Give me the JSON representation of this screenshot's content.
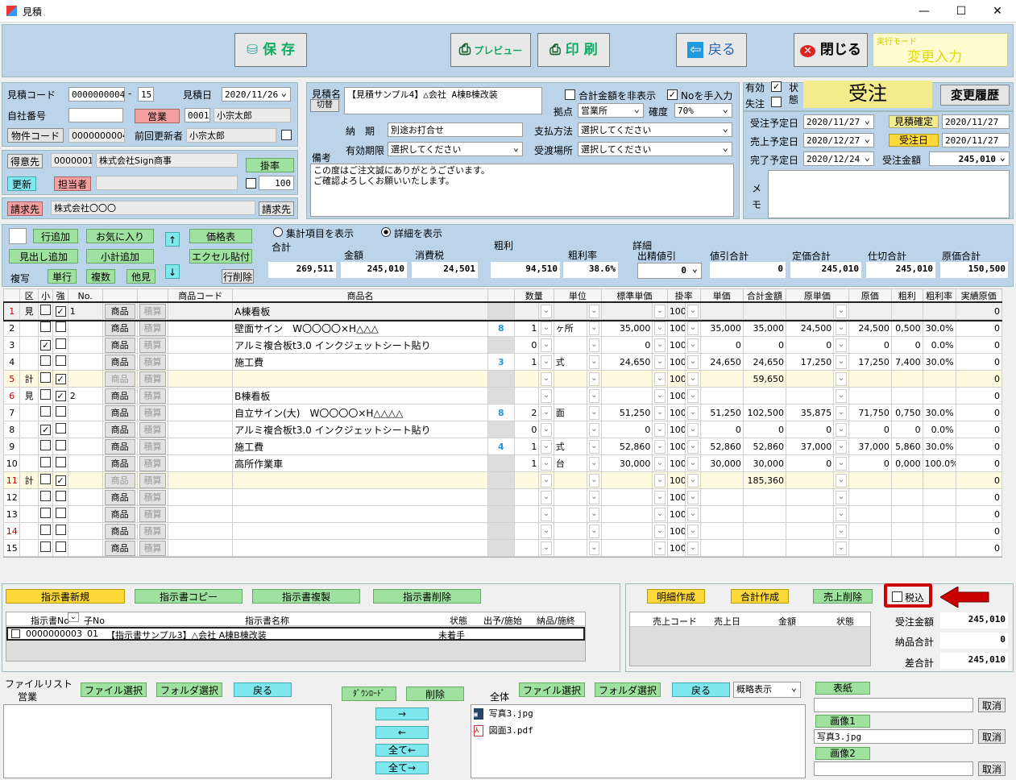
{
  "window": {
    "title": "見積",
    "min": "—",
    "max": "☐",
    "close": "✕"
  },
  "toolbar": {
    "save": "保 存",
    "preview": "プレビュー",
    "print": "印 刷",
    "back": "戻る",
    "close": "閉じる",
    "mode_label": "実行モード",
    "mode_value": "変更入力"
  },
  "left": {
    "quote_code_label": "見積コード",
    "quote_code": "0000000004",
    "quote_sep": "-",
    "quote_sub": "15",
    "quote_date_label": "見積日",
    "quote_date": "2020/11/26",
    "company_no_label": "自社番号",
    "sales_btn": "営業",
    "staff_code": "0001",
    "staff_name": "小宗太郎",
    "property_code_btn": "物件コード",
    "property_code": "0000000004",
    "last_updater_label": "前回更新者",
    "last_updater": "小宗太郎",
    "customer_btn": "得意先",
    "customer_code": "0000001",
    "customer_name": "株式会社Sign商事",
    "rate_btn": "掛率",
    "update_btn": "更新",
    "person_btn": "担当者",
    "rate_value": "100",
    "billing_btn": "請求先",
    "billing_name": "株式会社〇〇〇",
    "billing_action": "請求先"
  },
  "middle": {
    "quote_name_label": "見積名",
    "switch_btn": "切替",
    "quote_name": "【見積サンプル4】△会社 A棟B棟改装",
    "hide_total_label": "合計金額を非表示",
    "manual_no_label": "Noを手入力",
    "base_label": "拠点",
    "base_value": "営業所",
    "certainty_label": "確度",
    "certainty_value": "70%",
    "delivery_label": "納　期",
    "delivery_value": "別途お打合せ",
    "payment_label": "支払方法",
    "payment_value": "選択してください",
    "validity_label": "有効期限",
    "validity_value": "選択してください",
    "handover_label": "受渡場所",
    "handover_value": "選択してください",
    "notes_label": "備考",
    "notes_line1": "この度はご注文誠にありがとうございます。",
    "notes_line2": "ご確認よろしくお願いいたします。"
  },
  "right": {
    "valid_label": "有効",
    "lost_label": "失注",
    "status_label1": "状",
    "status_label2": "態",
    "status_value": "受注",
    "history_btn": "変更履歴",
    "order_plan_label": "受注予定日",
    "order_plan": "2020/11/27",
    "quote_confirm_btn": "見積確定",
    "quote_confirm_date": "2020/11/27",
    "sales_plan_label": "売上予定日",
    "sales_plan": "2020/12/27",
    "order_date_btn": "受注日",
    "order_date": "2020/11/27",
    "complete_plan_label": "完了予定日",
    "complete_plan": "2020/12/24",
    "order_amount_label": "受注金額",
    "order_amount": "245,010",
    "memo_label1": "メ",
    "memo_label2": "モ"
  },
  "summary": {
    "show_total_label": "集計項目を表示",
    "show_detail_label": "詳細を表示",
    "add_row": "行追加",
    "favorites": "お気に入り",
    "price_table": "価格表",
    "heading_add": "見出し追加",
    "subtotal_add": "小計追加",
    "excel_paste": "エクセル貼付",
    "copy_label": "複写",
    "single": "単行",
    "multi": "複数",
    "other": "他見",
    "delete_row": "行削除",
    "total_label": "合計",
    "amount_label": "金額",
    "tax_label": "消費税",
    "total": "269,511",
    "amount": "245,010",
    "tax": "24,501",
    "gross_label": "粗利",
    "gross_rate_label": "粗利率",
    "gross": "94,510",
    "gross_rate": "38.6%",
    "detail_label": "詳細",
    "discount_label": "出精値引",
    "discount": "0",
    "discount_total_label": "値引合計",
    "discount_total": "0",
    "list_total_label": "定価合計",
    "list_total": "245,010",
    "cost_total_label": "仕切合計",
    "cost_total": "245,010",
    "orig_total_label": "原価合計",
    "orig_total": "150,500"
  },
  "grid": {
    "headers": [
      "区",
      "小",
      "強",
      "No.",
      "",
      "",
      "商品コード",
      "商品名",
      "",
      "数量",
      "単位",
      "標準単価",
      "掛率",
      "単価",
      "合計金額",
      "原単価",
      "原価",
      "粗利",
      "粗利率",
      "実績原価"
    ],
    "rows": [
      {
        "n": "1",
        "k": "見",
        "s": false,
        "st": true,
        "no": "1",
        "name": "A棟看板",
        "badge": "",
        "qty": "",
        "unit": "",
        "std": "",
        "rate": "100",
        "price": "",
        "total": "",
        "ucost": "",
        "cost": "",
        "gp": "",
        "gpr": "",
        "act": "0",
        "type": "h"
      },
      {
        "n": "2",
        "k": "",
        "s": false,
        "st": false,
        "no": "",
        "name": "壁面サイン　W〇〇〇〇×H△△△",
        "badge": "8",
        "qty": "1",
        "unit": "ヶ所",
        "std": "35,000",
        "rate": "100",
        "price": "35,000",
        "total": "35,000",
        "ucost": "24,500",
        "cost": "24,500",
        "gp": "0,500",
        "gpr": "30.0%",
        "act": "0",
        "type": "n"
      },
      {
        "n": "3",
        "k": "",
        "s": true,
        "st": false,
        "no": "",
        "name": "アルミ複合板t3.0 インクジェットシート貼り",
        "badge": "",
        "qty": "0",
        "unit": "",
        "std": "0",
        "rate": "100",
        "price": "0",
        "total": "0",
        "ucost": "0",
        "cost": "0",
        "gp": "0",
        "gpr": "0.0%",
        "act": "0",
        "type": "n"
      },
      {
        "n": "4",
        "k": "",
        "s": false,
        "st": false,
        "no": "",
        "name": "施工費",
        "badge": "3",
        "qty": "1",
        "unit": "式",
        "std": "24,650",
        "rate": "100",
        "price": "24,650",
        "total": "24,650",
        "ucost": "17,250",
        "cost": "17,250",
        "gp": "7,400",
        "gpr": "30.0%",
        "act": "0",
        "type": "n"
      },
      {
        "n": "5",
        "k": "計",
        "s": false,
        "st": true,
        "no": "",
        "name": "",
        "badge": "",
        "qty": "",
        "unit": "",
        "std": "",
        "rate": "100",
        "price": "",
        "total": "59,650",
        "ucost": "",
        "cost": "",
        "gp": "",
        "gpr": "",
        "act": "0",
        "type": "t"
      },
      {
        "n": "6",
        "k": "見",
        "s": false,
        "st": true,
        "no": "2",
        "name": "B棟看板",
        "badge": "",
        "qty": "",
        "unit": "",
        "std": "",
        "rate": "100",
        "price": "",
        "total": "",
        "ucost": "",
        "cost": "",
        "gp": "",
        "gpr": "",
        "act": "0",
        "type": "h"
      },
      {
        "n": "7",
        "k": "",
        "s": false,
        "st": false,
        "no": "",
        "name": "自立サイン(大)　W〇〇〇〇×H△△△△",
        "badge": "8",
        "qty": "2",
        "unit": "面",
        "std": "51,250",
        "rate": "100",
        "price": "51,250",
        "total": "102,500",
        "ucost": "35,875",
        "cost": "71,750",
        "gp": "0,750",
        "gpr": "30.0%",
        "act": "0",
        "type": "n"
      },
      {
        "n": "8",
        "k": "",
        "s": true,
        "st": false,
        "no": "",
        "name": "アルミ複合板t3.0 インクジェットシート貼り",
        "badge": "",
        "qty": "0",
        "unit": "",
        "std": "0",
        "rate": "100",
        "price": "0",
        "total": "0",
        "ucost": "0",
        "cost": "0",
        "gp": "0",
        "gpr": "0.0%",
        "act": "0",
        "type": "n"
      },
      {
        "n": "9",
        "k": "",
        "s": false,
        "st": false,
        "no": "",
        "name": "施工費",
        "badge": "4",
        "qty": "1",
        "unit": "式",
        "std": "52,860",
        "rate": "100",
        "price": "52,860",
        "total": "52,860",
        "ucost": "37,000",
        "cost": "37,000",
        "gp": "5,860",
        "gpr": "30.0%",
        "act": "0",
        "type": "n"
      },
      {
        "n": "10",
        "k": "",
        "s": false,
        "st": false,
        "no": "",
        "name": "高所作業車",
        "badge": "",
        "qty": "1",
        "unit": "台",
        "std": "30,000",
        "rate": "100",
        "price": "30,000",
        "total": "30,000",
        "ucost": "0",
        "cost": "0",
        "gp": "0,000",
        "gpr": "100.0%",
        "act": "0",
        "type": "n"
      },
      {
        "n": "11",
        "k": "計",
        "s": false,
        "st": true,
        "no": "",
        "name": "",
        "badge": "",
        "qty": "",
        "unit": "",
        "std": "",
        "rate": "100",
        "price": "",
        "total": "185,360",
        "ucost": "",
        "cost": "",
        "gp": "",
        "gpr": "",
        "act": "0",
        "type": "t"
      },
      {
        "n": "12",
        "k": "",
        "s": false,
        "st": false,
        "no": "",
        "name": "",
        "badge": "",
        "qty": "",
        "unit": "",
        "std": "",
        "rate": "100",
        "price": "",
        "total": "",
        "ucost": "",
        "cost": "",
        "gp": "",
        "gpr": "",
        "act": "0",
        "type": "n"
      },
      {
        "n": "13",
        "k": "",
        "s": false,
        "st": false,
        "no": "",
        "name": "",
        "badge": "",
        "qty": "",
        "unit": "",
        "std": "",
        "rate": "100",
        "price": "",
        "total": "",
        "ucost": "",
        "cost": "",
        "gp": "",
        "gpr": "",
        "act": "0",
        "type": "n"
      },
      {
        "n": "14",
        "k": "",
        "s": false,
        "st": false,
        "no": "",
        "name": "",
        "badge": "",
        "qty": "",
        "unit": "",
        "std": "",
        "rate": "100",
        "price": "",
        "total": "",
        "ucost": "",
        "cost": "",
        "gp": "",
        "gpr": "",
        "act": "0",
        "type": "n"
      },
      {
        "n": "15",
        "k": "",
        "s": false,
        "st": false,
        "no": "",
        "name": "",
        "badge": "",
        "qty": "",
        "unit": "",
        "std": "",
        "rate": "100",
        "price": "",
        "total": "",
        "ucost": "",
        "cost": "",
        "gp": "",
        "gpr": "",
        "act": "0",
        "type": "n"
      }
    ],
    "product_btn": "商品",
    "estimate_btn": "積算"
  },
  "orders": {
    "new": "指示書新規",
    "copy": "指示書コピー",
    "dup": "指示書複製",
    "del": "指示書削除",
    "h_no": "指示書No",
    "h_sub": "子No",
    "h_name": "指示書名称",
    "h_status": "状態",
    "h_out": "出予/施始",
    "h_deliv": "納品/施終",
    "row_no": "0000000003",
    "row_sub": "01",
    "row_name": "【指示書サンプル3】△会社 A棟B棟改装",
    "row_status": "未着手"
  },
  "sales": {
    "detail_create": "明細作成",
    "total_create": "合計作成",
    "sales_delete": "売上削除",
    "tax_incl": "税込",
    "h_code": "売上コード",
    "h_date": "売上日",
    "h_amount": "金額",
    "h_status": "状態",
    "order_amount_label": "受注金額",
    "order_amount": "245,010",
    "deliv_total_label": "納品合計",
    "deliv_total": "0",
    "diff_label": "差合計",
    "diff": "245,010"
  },
  "files": {
    "list_label": "ファイルリスト",
    "sales_label": "営業",
    "file_select": "ファイル選択",
    "folder_select": "フォルダ選択",
    "back": "戻る",
    "download": "ﾀﾞｳﾝﾛｰﾄﾞ",
    "delete": "削除",
    "right": "→",
    "left": "←",
    "all_left": "全て←",
    "all_right": "全て→",
    "all_label": "全体",
    "file_select2": "ファイル選択",
    "folder_select2": "フォルダ選択",
    "back2": "戻る",
    "view_mode": "概略表示",
    "file1": "写真3.jpg",
    "file2": "図面3.pdf",
    "cover_btn": "表紙",
    "image1_btn": "画像1",
    "image1_value": "写真3.jpg",
    "image2_btn": "画像2",
    "cancel": "取消"
  }
}
